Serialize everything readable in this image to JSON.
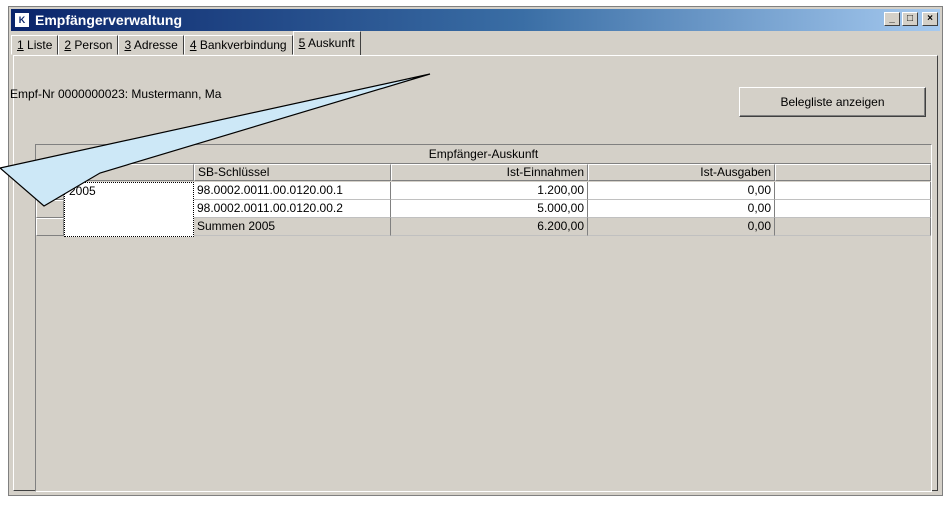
{
  "window": {
    "title": "Empfängerverwaltung",
    "icon_label": "K"
  },
  "tabs": [
    {
      "num": "1",
      "label": "Liste"
    },
    {
      "num": "2",
      "label": "Person"
    },
    {
      "num": "3",
      "label": "Adresse"
    },
    {
      "num": "4",
      "label": "Bankverbindung"
    },
    {
      "num": "5",
      "label": "Auskunft"
    }
  ],
  "info_text": "Empf-Nr 0000000023: Mustermann, Ma",
  "belegliste_button": "Belegliste anzeigen",
  "grid": {
    "title": "Empfänger-Auskunft",
    "columns": [
      "",
      "SB-Schlüssel",
      "Ist-Einnahmen",
      "Ist-Ausgaben"
    ],
    "year": "2005",
    "rows": [
      {
        "key": "98.0002.0011.00.0120.00.1",
        "einnahmen": "1.200,00",
        "ausgaben": "0,00"
      },
      {
        "key": "98.0002.0011.00.0120.00.2",
        "einnahmen": "5.000,00",
        "ausgaben": "0,00"
      },
      {
        "key": "Summen 2005",
        "einnahmen": "6.200,00",
        "ausgaben": "0,00"
      }
    ]
  },
  "colors": {
    "title_bar_start": "#0a246a",
    "title_bar_end": "#a6caf0",
    "face": "#d4d0c8",
    "callout_fill": "#cde8f7"
  }
}
